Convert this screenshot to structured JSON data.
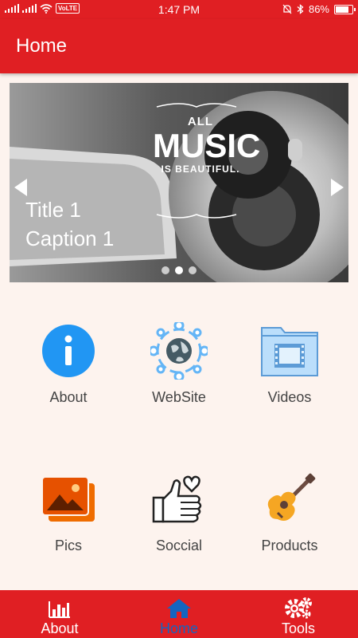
{
  "status_bar": {
    "time": "1:47 PM",
    "volte": "VoLTE",
    "battery": "86%",
    "battery_level": 0.86
  },
  "app_bar": {
    "title": "Home"
  },
  "slider": {
    "slide_title": "Title 1",
    "slide_caption": "Caption 1",
    "image_text_all": "ALL",
    "image_text_music": "MUSIC",
    "image_text_is": "IS BEAUTIFUL.",
    "dots": 3,
    "active_dot": 1
  },
  "tiles": [
    {
      "label": "About",
      "icon": "info-icon"
    },
    {
      "label": "WebSite",
      "icon": "globe-network-icon"
    },
    {
      "label": "Videos",
      "icon": "video-folder-icon"
    },
    {
      "label": "Pics",
      "icon": "pictures-icon"
    },
    {
      "label": "Soccial",
      "icon": "thumbs-up-heart-icon"
    },
    {
      "label": "Products",
      "icon": "guitar-icon"
    }
  ],
  "bottom_nav": {
    "items": [
      {
        "label": "About",
        "icon": "bar-chart-icon",
        "active": false
      },
      {
        "label": "Home",
        "icon": "home-icon",
        "active": true
      },
      {
        "label": "Tools",
        "icon": "gears-icon",
        "active": false
      }
    ]
  },
  "colors": {
    "primary": "#e01f23",
    "background": "#fdf3ee",
    "active_nav": "#1565c0",
    "info_blue": "#2196f3"
  }
}
